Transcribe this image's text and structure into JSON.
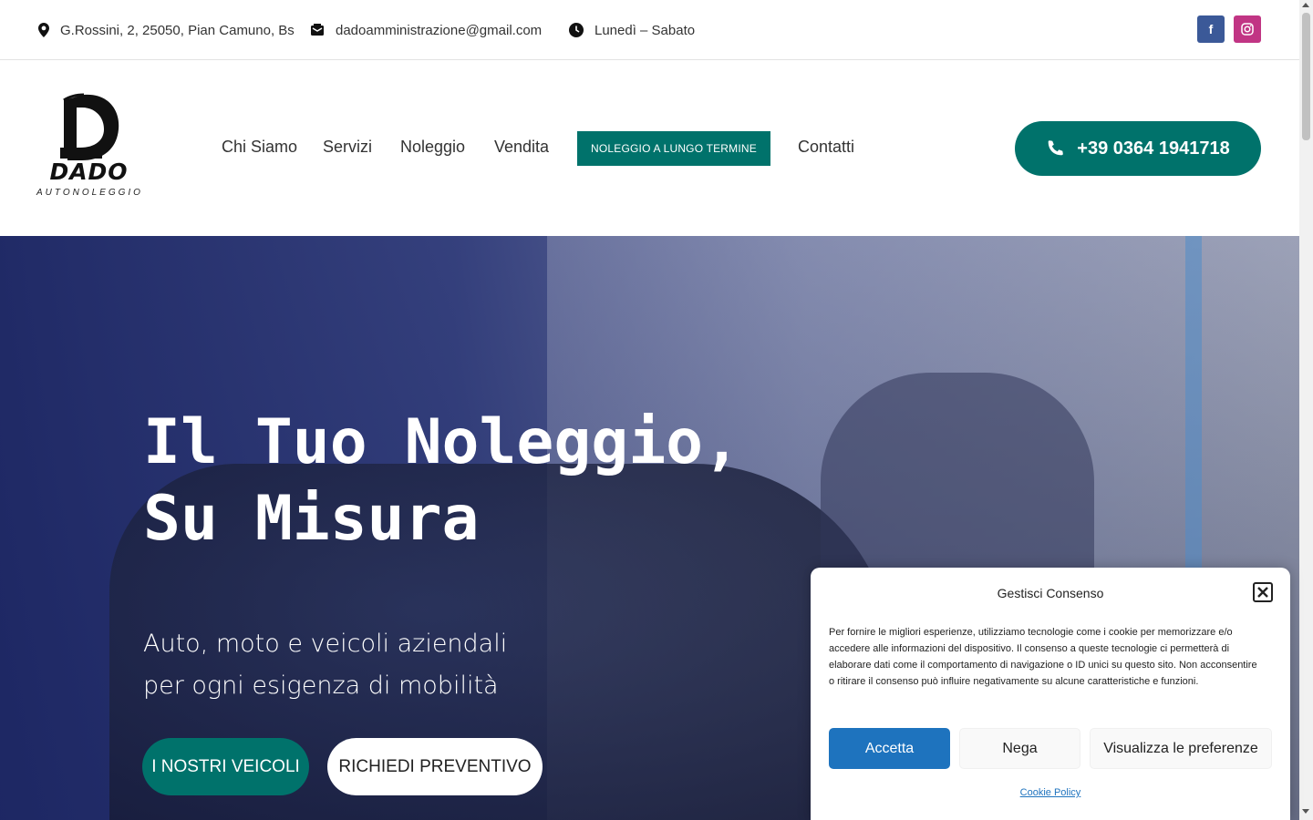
{
  "topbar": {
    "address": "G.Rossini, 2, 25050, Pian Camuno, Bs",
    "email": "dadoamministrazione@gmail.com",
    "hours": "Lunedì – Sabato",
    "facebook_glyph": "f",
    "facebook_color": "#3b5998",
    "instagram_color": "#c13584"
  },
  "logo": {
    "name": "DADO",
    "tagline": "AUTONOLEGGIO"
  },
  "nav": {
    "items": [
      "Chi Siamo",
      "Servizi",
      "Noleggio",
      "Vendita"
    ],
    "highlight": "NOLEGGIO A LUNGO TERMINE",
    "contact": "Contatti",
    "phone": "+39 0364 1941718"
  },
  "hero": {
    "title_line1": "Il Tuo Noleggio,",
    "title_line2": "Su Misura",
    "subtitle_line1": "Auto, moto e veicoli aziendali",
    "subtitle_line2": "per ogni esigenza di mobilità",
    "cta_primary": "I NOSTRI VEICOLI",
    "cta_secondary": "RICHIEDI PREVENTIVO"
  },
  "consent": {
    "title": "Gestisci Consenso",
    "text": "Per fornire le migliori esperienze, utilizziamo tecnologie come i cookie per memorizzare e/o accedere alle informazioni del dispositivo. Il consenso a queste tecnologie ci permetterà di elaborare dati come il comportamento di navigazione o ID unici su questo sito. Non acconsentire o ritirare il consenso può influire negativamente su alcune caratteristiche e funzioni.",
    "accept": "Accetta",
    "deny": "Nega",
    "preferences": "Visualizza le preferenze",
    "policy": "Cookie Policy"
  },
  "colors": {
    "brand_teal": "#00726b",
    "accept_blue": "#1e73be"
  }
}
